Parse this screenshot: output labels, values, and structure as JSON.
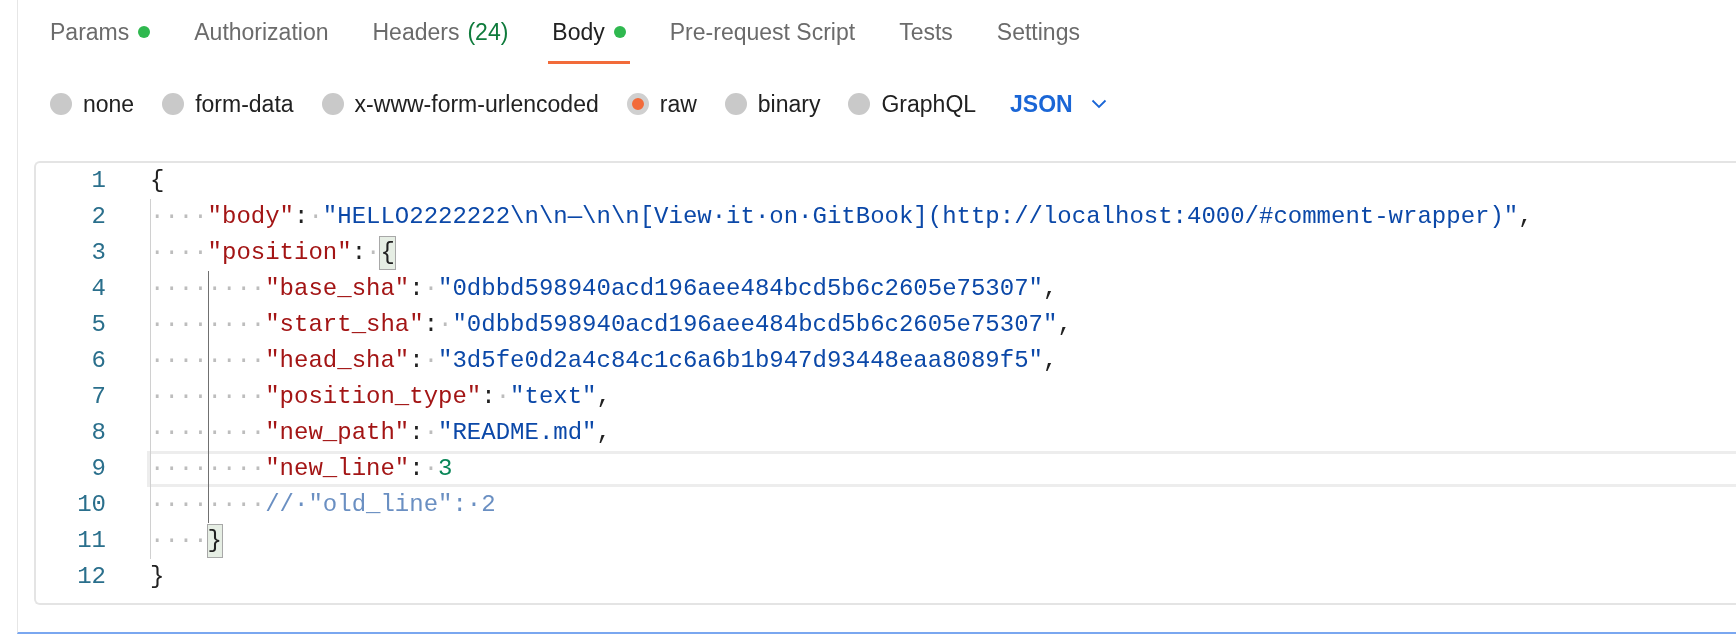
{
  "tabs": [
    {
      "label": "Params",
      "dot": true,
      "selected": false
    },
    {
      "label": "Authorization",
      "dot": false,
      "selected": false
    },
    {
      "label": "Headers",
      "count": "(24)",
      "dot": false,
      "selected": false
    },
    {
      "label": "Body",
      "dot": true,
      "selected": true
    },
    {
      "label": "Pre-request Script",
      "dot": false,
      "selected": false
    },
    {
      "label": "Tests",
      "dot": false,
      "selected": false
    },
    {
      "label": "Settings",
      "dot": false,
      "selected": false
    }
  ],
  "body_types": [
    {
      "label": "none",
      "selected": false
    },
    {
      "label": "form-data",
      "selected": false
    },
    {
      "label": "x-www-form-urlencoded",
      "selected": false
    },
    {
      "label": "raw",
      "selected": true
    },
    {
      "label": "binary",
      "selected": false
    },
    {
      "label": "GraphQL",
      "selected": false
    }
  ],
  "format_dropdown": {
    "value": "JSON"
  },
  "editor": {
    "lines": [
      {
        "number": "1",
        "current": false,
        "tokens": [
          {
            "kind": "punct",
            "text": "{"
          }
        ]
      },
      {
        "number": "2",
        "current": false,
        "tokens": [
          {
            "kind": "ws",
            "text": "····"
          },
          {
            "kind": "key",
            "text": "\"body\""
          },
          {
            "kind": "punct",
            "text": ":"
          },
          {
            "kind": "ws",
            "text": "·"
          },
          {
            "kind": "string",
            "text": "\"HELLO2222222\\n\\n—\\n\\n[View·it·on·GitBook](http://localhost:4000/#comment-wrapper)\""
          },
          {
            "kind": "punct",
            "text": ","
          }
        ]
      },
      {
        "number": "3",
        "current": false,
        "tokens": [
          {
            "kind": "ws",
            "text": "····"
          },
          {
            "kind": "key",
            "text": "\"position\""
          },
          {
            "kind": "punct",
            "text": ":"
          },
          {
            "kind": "ws",
            "text": "·"
          },
          {
            "kind": "bracket-match",
            "text": "{"
          }
        ]
      },
      {
        "number": "4",
        "current": false,
        "tokens": [
          {
            "kind": "ws",
            "text": "········"
          },
          {
            "kind": "key",
            "text": "\"base_sha\""
          },
          {
            "kind": "punct",
            "text": ":"
          },
          {
            "kind": "ws",
            "text": "·"
          },
          {
            "kind": "string",
            "text": "\"0dbbd598940acd196aee484bcd5b6c2605e75307\""
          },
          {
            "kind": "punct",
            "text": ","
          }
        ]
      },
      {
        "number": "5",
        "current": false,
        "tokens": [
          {
            "kind": "ws",
            "text": "········"
          },
          {
            "kind": "key",
            "text": "\"start_sha\""
          },
          {
            "kind": "punct",
            "text": ":"
          },
          {
            "kind": "ws",
            "text": "·"
          },
          {
            "kind": "string",
            "text": "\"0dbbd598940acd196aee484bcd5b6c2605e75307\""
          },
          {
            "kind": "punct",
            "text": ","
          }
        ]
      },
      {
        "number": "6",
        "current": false,
        "tokens": [
          {
            "kind": "ws",
            "text": "········"
          },
          {
            "kind": "key",
            "text": "\"head_sha\""
          },
          {
            "kind": "punct",
            "text": ":"
          },
          {
            "kind": "ws",
            "text": "·"
          },
          {
            "kind": "string",
            "text": "\"3d5fe0d2a4c84c1c6a6b1b947d93448eaa8089f5\""
          },
          {
            "kind": "punct",
            "text": ","
          }
        ]
      },
      {
        "number": "7",
        "current": false,
        "tokens": [
          {
            "kind": "ws",
            "text": "········"
          },
          {
            "kind": "key",
            "text": "\"position_type\""
          },
          {
            "kind": "punct",
            "text": ":"
          },
          {
            "kind": "ws",
            "text": "·"
          },
          {
            "kind": "string",
            "text": "\"text\""
          },
          {
            "kind": "punct",
            "text": ","
          }
        ]
      },
      {
        "number": "8",
        "current": false,
        "tokens": [
          {
            "kind": "ws",
            "text": "········"
          },
          {
            "kind": "key",
            "text": "\"new_path\""
          },
          {
            "kind": "punct",
            "text": ":"
          },
          {
            "kind": "ws",
            "text": "·"
          },
          {
            "kind": "string",
            "text": "\"README.md\""
          },
          {
            "kind": "punct",
            "text": ","
          }
        ]
      },
      {
        "number": "9",
        "current": true,
        "tokens": [
          {
            "kind": "ws",
            "text": "········"
          },
          {
            "kind": "key",
            "text": "\"new_line\""
          },
          {
            "kind": "punct",
            "text": ":"
          },
          {
            "kind": "ws",
            "text": "·"
          },
          {
            "kind": "number",
            "text": "3"
          }
        ]
      },
      {
        "number": "10",
        "current": false,
        "tokens": [
          {
            "kind": "ws",
            "text": "········"
          },
          {
            "kind": "comment",
            "text": "//·\"old_line\":·2"
          }
        ]
      },
      {
        "number": "11",
        "current": false,
        "tokens": [
          {
            "kind": "ws",
            "text": "····"
          },
          {
            "kind": "bracket-match",
            "text": "}"
          }
        ]
      },
      {
        "number": "12",
        "current": false,
        "tokens": [
          {
            "kind": "punct",
            "text": "}"
          }
        ]
      }
    ]
  }
}
